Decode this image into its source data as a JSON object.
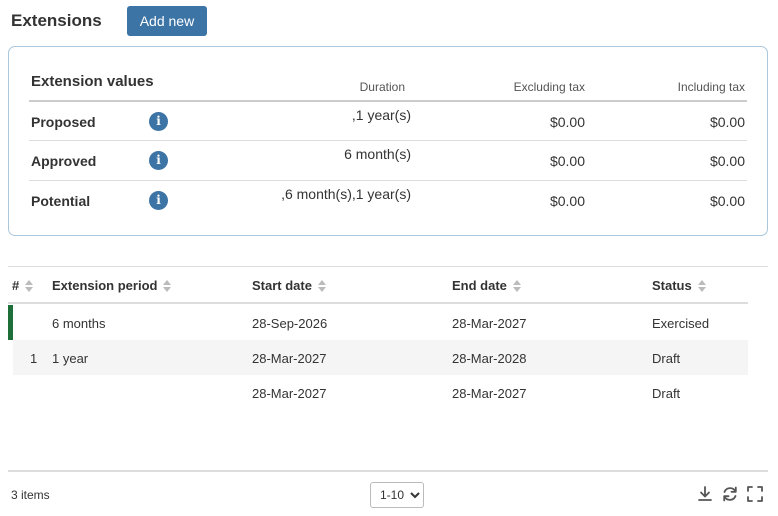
{
  "header": {
    "title": "Extensions",
    "add_new_label": "Add new"
  },
  "extension_values": {
    "title": "Extension values",
    "columns": {
      "duration": "Duration",
      "excluding_tax": "Excluding tax",
      "including_tax": "Including tax"
    },
    "rows": [
      {
        "label": "Proposed",
        "duration": ",1 year(s)",
        "excluding_tax": "$0.00",
        "including_tax": "$0.00"
      },
      {
        "label": "Approved",
        "duration": "6 month(s)",
        "excluding_tax": "$0.00",
        "including_tax": "$0.00"
      },
      {
        "label": "Potential",
        "duration": ",6 month(s),1 year(s)",
        "excluding_tax": "$0.00",
        "including_tax": "$0.00"
      }
    ],
    "info_icon": "info-icon"
  },
  "table": {
    "columns": {
      "number": "#",
      "period": "Extension period",
      "start": "Start date",
      "end": "End date",
      "status": "Status"
    },
    "rows": [
      {
        "number": "",
        "period": "6 months",
        "start": "28-Sep-2026",
        "end": "28-Mar-2027",
        "status": "Exercised"
      },
      {
        "number": "1",
        "period": "1 year",
        "start": "28-Mar-2027",
        "end": "28-Mar-2028",
        "status": "Draft"
      },
      {
        "number": "",
        "period": "",
        "start": "28-Mar-2027",
        "end": "28-Mar-2027",
        "status": "Draft"
      }
    ],
    "exercised_marker_color": "#1e6e3a"
  },
  "footer": {
    "items_count": "3 items",
    "page_size_selected": "1-10",
    "icons": [
      "download-icon",
      "refresh-icon",
      "fullscreen-icon"
    ]
  },
  "colors": {
    "accent": "#3d74a6",
    "panel_border": "#a9c7dd"
  }
}
